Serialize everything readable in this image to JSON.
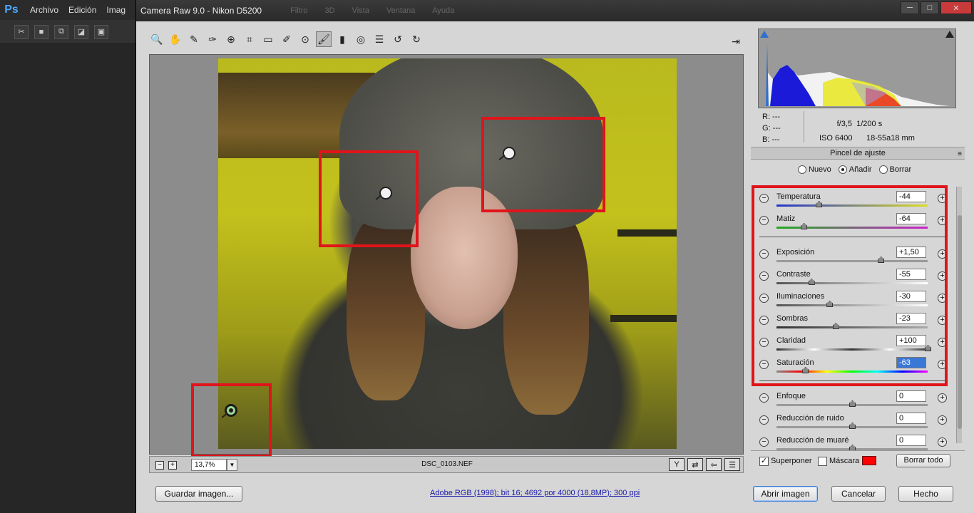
{
  "photoshop": {
    "logo": "Ps",
    "menu": [
      "Archivo",
      "Edición",
      "Imag"
    ]
  },
  "dialog": {
    "title": "Camera Raw 9.0 -  Nikon D5200",
    "ghost_menu": [
      "Filtro",
      "3D",
      "Vista",
      "Ventana",
      "Ayuda"
    ]
  },
  "toolbar": {
    "tools": [
      {
        "name": "zoom-tool",
        "glyph": "🔍"
      },
      {
        "name": "hand-tool",
        "glyph": "✋"
      },
      {
        "name": "white-balance-tool",
        "glyph": "✎"
      },
      {
        "name": "color-sampler-tool",
        "glyph": "✑"
      },
      {
        "name": "targeted-adjustment-tool",
        "glyph": "⊕"
      },
      {
        "name": "crop-tool",
        "glyph": "⌗"
      },
      {
        "name": "straighten-tool",
        "glyph": "▭"
      },
      {
        "name": "spot-removal-tool",
        "glyph": "✐"
      },
      {
        "name": "red-eye-tool",
        "glyph": "⊙"
      },
      {
        "name": "adjustment-brush-tool",
        "glyph": "🖌"
      },
      {
        "name": "graduated-filter-tool",
        "glyph": "▮"
      },
      {
        "name": "radial-filter-tool",
        "glyph": "◎"
      },
      {
        "name": "preferences-tool",
        "glyph": "☰"
      },
      {
        "name": "rotate-left-tool",
        "glyph": "↺"
      },
      {
        "name": "rotate-right-tool",
        "glyph": "↻"
      }
    ],
    "active_tool": "adjustment-brush-tool"
  },
  "status": {
    "zoom": "13,7%",
    "filename": "DSC_0103.NEF"
  },
  "buttons": {
    "save": "Guardar imagen...",
    "open": "Abrir imagen",
    "cancel": "Cancelar",
    "done": "Hecho"
  },
  "workflow_link": "Adobe RGB (1998); bit 16; 4692 por 4000 (18,8MP); 300 ppi",
  "info": {
    "r": "R:   ---",
    "g": "G:   ---",
    "b": "B:   ---",
    "aperture": "f/3,5",
    "shutter": "1/200 s",
    "iso": "ISO 6400",
    "lens": "18-55a18 mm"
  },
  "panel": {
    "title": "Pincel de ajuste",
    "modes": [
      "Nuevo",
      "Añadir",
      "Borrar"
    ],
    "selected_mode": "Añadir",
    "sliders": [
      {
        "label": "Temperatura",
        "value": "-44",
        "pos": 0.28
      },
      {
        "label": "Matiz",
        "value": "-64",
        "pos": 0.18
      },
      {
        "label": "Exposición",
        "value": "+1,50",
        "pos": 0.69
      },
      {
        "label": "Contraste",
        "value": "-55",
        "pos": 0.23
      },
      {
        "label": "Iluminaciones",
        "value": "-30",
        "pos": 0.35
      },
      {
        "label": "Sombras",
        "value": "-23",
        "pos": 0.39
      },
      {
        "label": "Claridad",
        "value": "+100",
        "pos": 1.0
      },
      {
        "label": "Saturación",
        "value": "-63",
        "pos": 0.19
      },
      {
        "label": "Enfoque",
        "value": "0",
        "pos": 0.5
      },
      {
        "label": "Reducción de ruido",
        "value": "0",
        "pos": 0.5
      },
      {
        "label": "Reducción de muaré",
        "value": "0",
        "pos": 0.5
      }
    ],
    "overlay_label": "Superponer",
    "overlay_checked": true,
    "mask_label": "Máscara",
    "mask_checked": false,
    "mask_color": "#ff0000",
    "clear_all": "Borrar todo"
  },
  "accents": {
    "highlight": "#e0141b"
  }
}
